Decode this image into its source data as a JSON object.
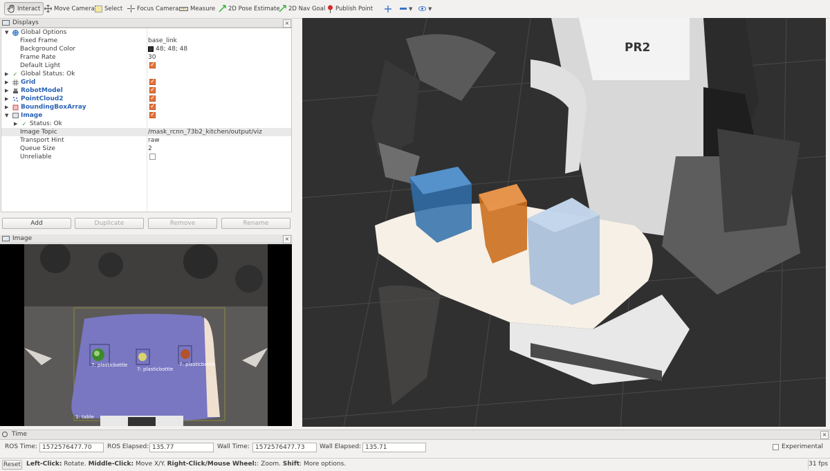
{
  "toolbar": {
    "tools": [
      {
        "label": "Interact",
        "icon": "hand-icon"
      },
      {
        "label": "Move Camera",
        "icon": "move-camera-icon"
      },
      {
        "label": "Select",
        "icon": "select-icon"
      },
      {
        "label": "Focus Camera",
        "icon": "focus-camera-icon"
      },
      {
        "label": "Measure",
        "icon": "measure-icon"
      },
      {
        "label": "2D Pose Estimate",
        "icon": "pose-arrow-icon"
      },
      {
        "label": "2D Nav Goal",
        "icon": "nav-goal-arrow-icon"
      },
      {
        "label": "Publish Point",
        "icon": "pin-icon"
      }
    ]
  },
  "displays": {
    "title": "Displays",
    "rows": [
      {
        "label": "Global Options",
        "value": ""
      },
      {
        "label": "Fixed Frame",
        "value": "base_link"
      },
      {
        "label": "Background Color",
        "value": "48; 48; 48"
      },
      {
        "label": "Frame Rate",
        "value": "30"
      },
      {
        "label": "Default Light",
        "value": ""
      },
      {
        "label": "Global Status: Ok",
        "value": ""
      },
      {
        "label": "Grid",
        "value": ""
      },
      {
        "label": "RobotModel",
        "value": ""
      },
      {
        "label": "PointCloud2",
        "value": ""
      },
      {
        "label": "BoundingBoxArray",
        "value": ""
      },
      {
        "label": "Image",
        "value": ""
      },
      {
        "label": "Status: Ok",
        "value": ""
      },
      {
        "label": "Image Topic",
        "value": "/mask_rcnn_73b2_kitchen/output/viz"
      },
      {
        "label": "Transport Hint",
        "value": "raw"
      },
      {
        "label": "Queue Size",
        "value": "2"
      },
      {
        "label": "Unreliable",
        "value": ""
      }
    ],
    "buttons": {
      "add": "Add",
      "duplicate": "Duplicate",
      "remove": "Remove",
      "rename": "Rename"
    }
  },
  "image_panel": {
    "title": "Image",
    "detections": [
      {
        "label": "7: plasticbottle"
      },
      {
        "label": "7: plasticbottle"
      },
      {
        "label": "7: plasticbottle"
      },
      {
        "label": "1: table"
      }
    ]
  },
  "viewport": {
    "robot_label": "PR2"
  },
  "time": {
    "title": "Time",
    "ros_time_label": "ROS Time:",
    "ros_time": "1572576477.70",
    "ros_elapsed_label": "ROS Elapsed:",
    "ros_elapsed": "135.77",
    "wall_time_label": "Wall Time:",
    "wall_time": "1572576477.73",
    "wall_elapsed_label": "Wall Elapsed:",
    "wall_elapsed": "135.71",
    "experimental_label": "Experimental"
  },
  "status": {
    "reset_label": "Reset",
    "hint_left_click": "Left-Click:",
    "hint_rotate": "Rotate.",
    "hint_middle_click": "Middle-Click:",
    "hint_move": "Move X/Y.",
    "hint_right_click": "Right-Click/Mouse Wheel:",
    "hint_zoom": ": Zoom.",
    "hint_shift": "Shift",
    "hint_more": ": More options.",
    "fps": "31 fps"
  },
  "colors": {
    "background": "#303030",
    "accent_blue": "#2a62b4",
    "check_orange": "#e6733b",
    "box_blue": "#2f6eaa",
    "box_orange": "#cc6f1e",
    "box_light_blue": "#9db8d8"
  }
}
